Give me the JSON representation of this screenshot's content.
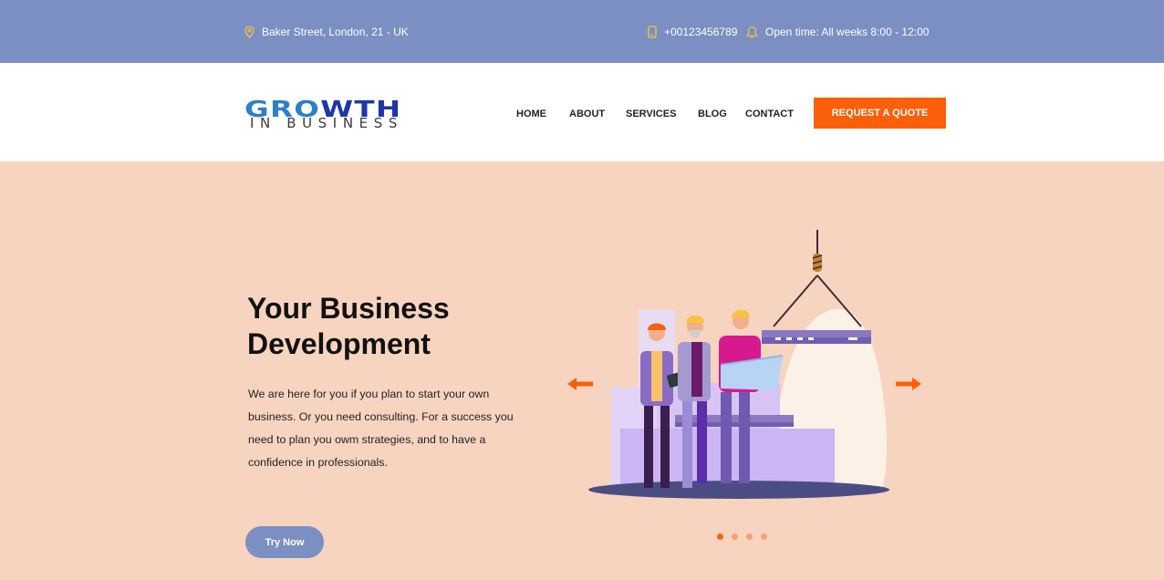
{
  "topbar": {
    "address": "Baker Street, London, 21 - UK",
    "phone": "+00123456789",
    "hours": "Open time: All weeks 8:00 - 12:00",
    "icons": [
      "location-pin-icon",
      "phone-icon",
      "bell-icon"
    ],
    "icon_color": "#f5c542"
  },
  "logo": {
    "line1_part1": "GRO",
    "line1_part2": "WTH",
    "line2": "IN BUSINESS"
  },
  "nav": {
    "items": [
      {
        "label": "HOME"
      },
      {
        "label": "ABOUT"
      },
      {
        "label": "SERVICES"
      },
      {
        "label": "BLOG"
      },
      {
        "label": "CONTACT"
      }
    ],
    "cta_label": "REQUEST A QUOTE"
  },
  "hero": {
    "title": "Your Business Development",
    "text": "We are here for you if you plan to start your own business. Or you need consulting. For a success you need to plan you owm strategies, and to have a confidence in professionals.",
    "button_label": "Try Now",
    "slides_count": 4,
    "active_slide": 1
  },
  "colors": {
    "topbar": "#7b8fc2",
    "hero_bg": "#f7d4c0",
    "accent": "#fb6008",
    "button": "#7b8fc2"
  }
}
